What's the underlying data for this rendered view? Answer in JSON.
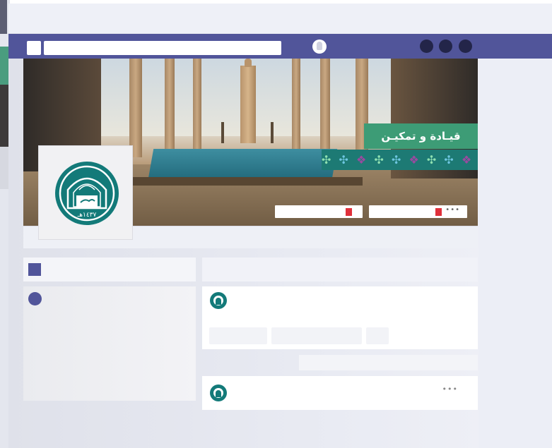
{
  "cover": {
    "slogan": "قيـادة و تمكيـن",
    "pattern_glyphs": [
      "✣",
      "✣",
      "❖",
      "✣",
      "✣",
      "❖",
      "✣",
      "✣",
      "❖",
      "✣"
    ]
  },
  "profile": {
    "logo_text": "١٤٣٧هـ",
    "logo_signature": "نورة"
  },
  "buttons": {
    "more": "•••"
  },
  "post2": {
    "more": "•••"
  },
  "colors": {
    "nav": "#51559a",
    "teal": "#137a79",
    "slogan_bg": "#3d9c76",
    "flag": "#e0303a"
  }
}
